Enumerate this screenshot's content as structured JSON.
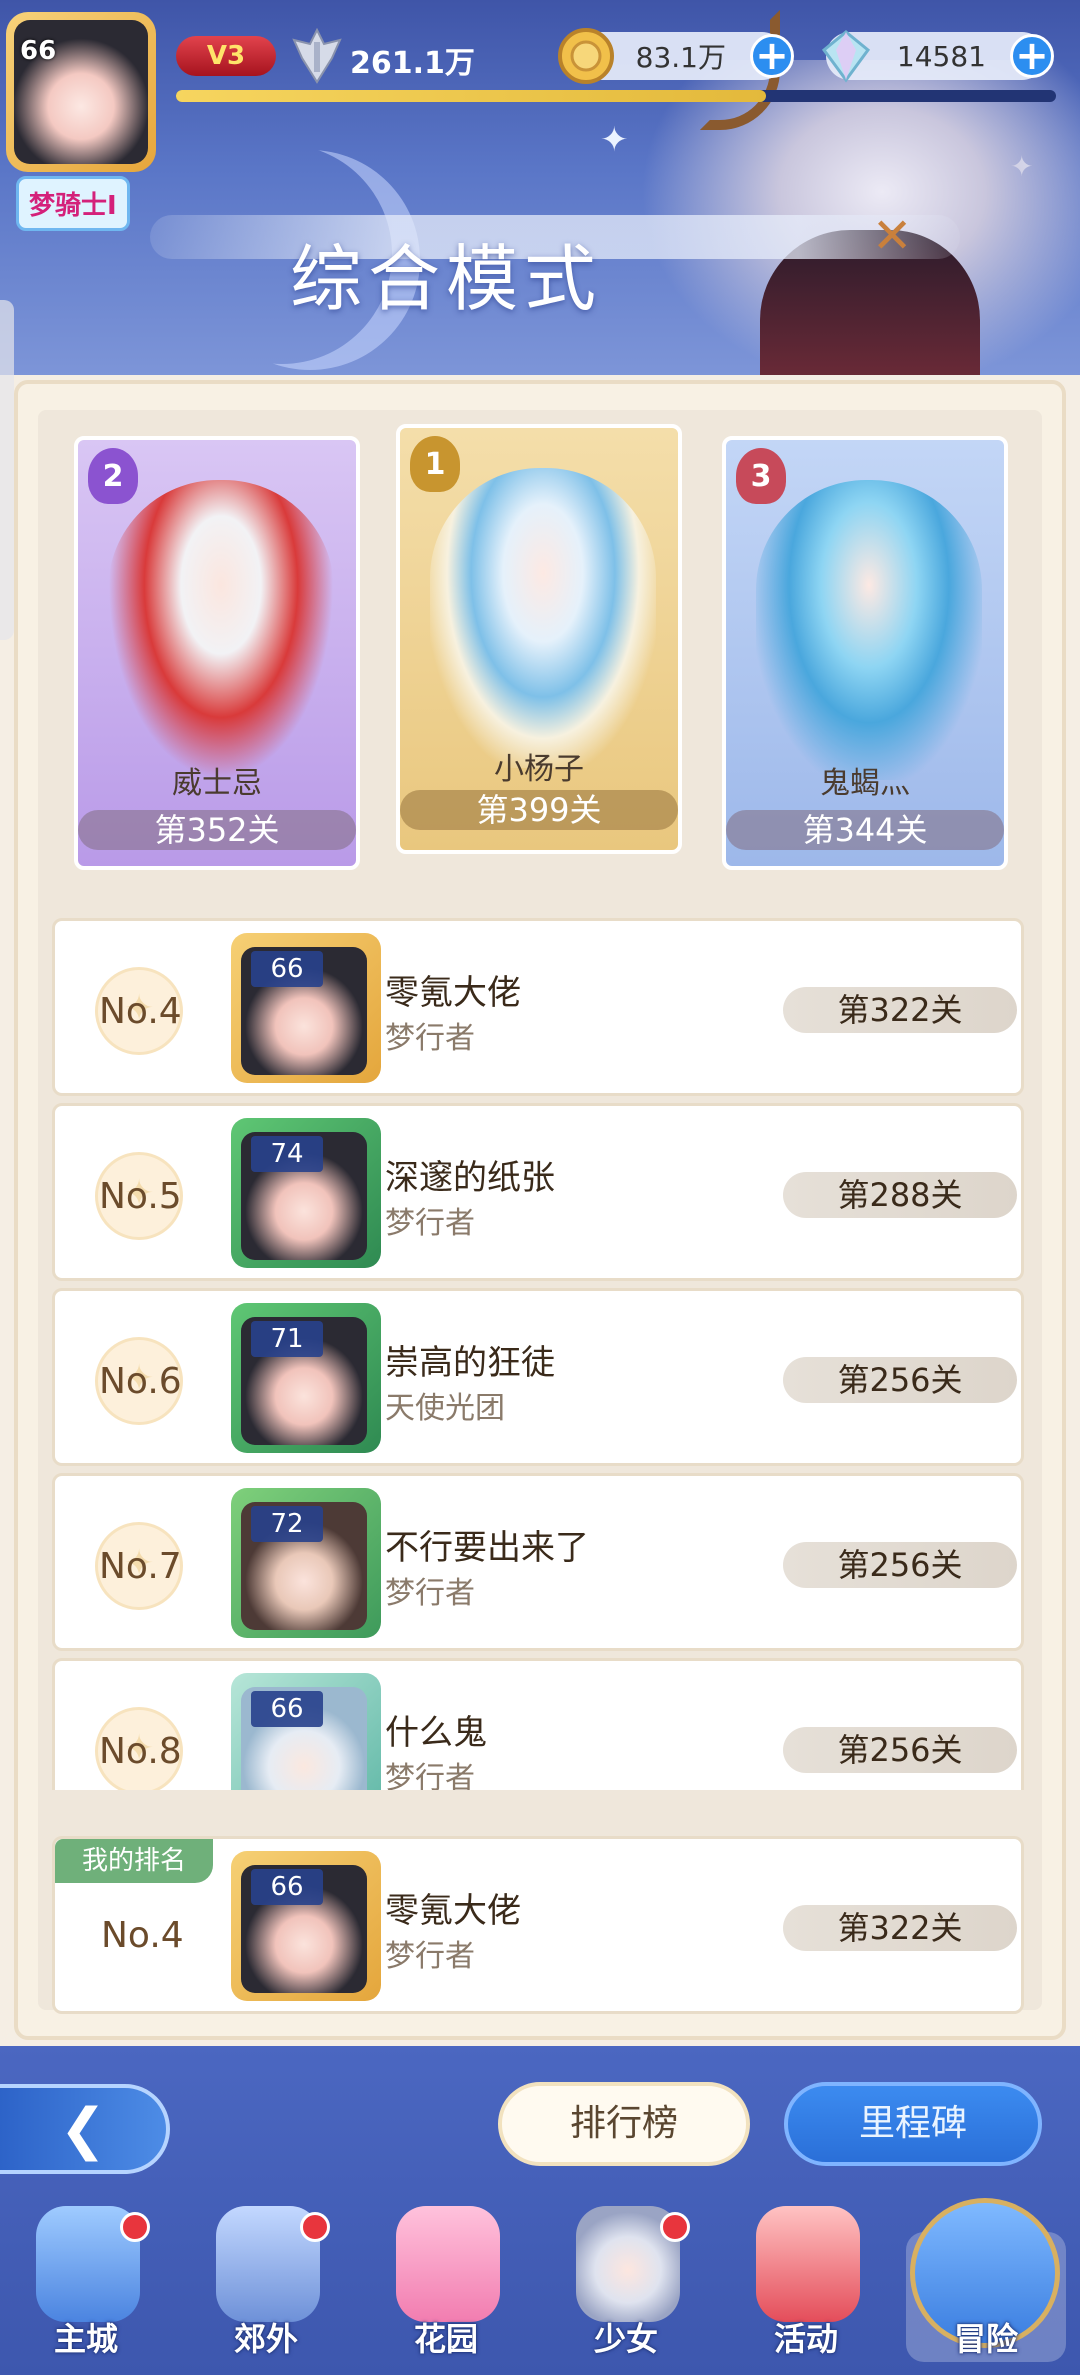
{
  "header": {
    "player_level": "66",
    "vip": "V3",
    "power": "261.1万",
    "exp_fraction": 0.67,
    "nickname_tag": "梦骑士I",
    "coins": "83.1万",
    "gems": "14581",
    "mode_title": "综合模式",
    "close_glyph": "✕"
  },
  "podium": [
    {
      "rank": "2",
      "name": "威士忌",
      "stage": "第352关"
    },
    {
      "rank": "1",
      "name": "小杨子",
      "stage": "第399关"
    },
    {
      "rank": "3",
      "name": "鬼蝎灬",
      "stage": "第344关"
    }
  ],
  "ranking": [
    {
      "no": "No.4",
      "level": "66",
      "name": "零氪大佬",
      "guild": "梦行者",
      "stage": "第322关"
    },
    {
      "no": "No.5",
      "level": "74",
      "name": "深邃的纸张",
      "guild": "梦行者",
      "stage": "第288关"
    },
    {
      "no": "No.6",
      "level": "71",
      "name": "崇高的狂徒",
      "guild": "天使光团",
      "stage": "第256关"
    },
    {
      "no": "No.7",
      "level": "72",
      "name": "不行要出来了",
      "guild": "梦行者",
      "stage": "第256关"
    },
    {
      "no": "No.8",
      "level": "66",
      "name": "什么鬼",
      "guild": "梦行者",
      "stage": "第256关"
    }
  ],
  "my_rank": {
    "tag": "我的排名",
    "no": "No.4",
    "level": "66",
    "name": "零氪大佬",
    "guild": "梦行者",
    "stage": "第322关"
  },
  "buttons": {
    "back_glyph": "❮",
    "leaderboard": "排行榜",
    "milestone": "里程碑"
  },
  "nav": [
    {
      "label": "主城",
      "icon": "castle-icon",
      "badge": true
    },
    {
      "label": "郊外",
      "icon": "outskirts-icon",
      "badge": true
    },
    {
      "label": "花园",
      "icon": "garden-heart-icon",
      "badge": false
    },
    {
      "label": "少女",
      "icon": "girl-portrait-icon",
      "badge": true
    },
    {
      "label": "活动",
      "icon": "gift-box-icon",
      "badge": false
    },
    {
      "label": "冒险",
      "icon": "compass-icon",
      "badge": false,
      "active": true
    }
  ]
}
